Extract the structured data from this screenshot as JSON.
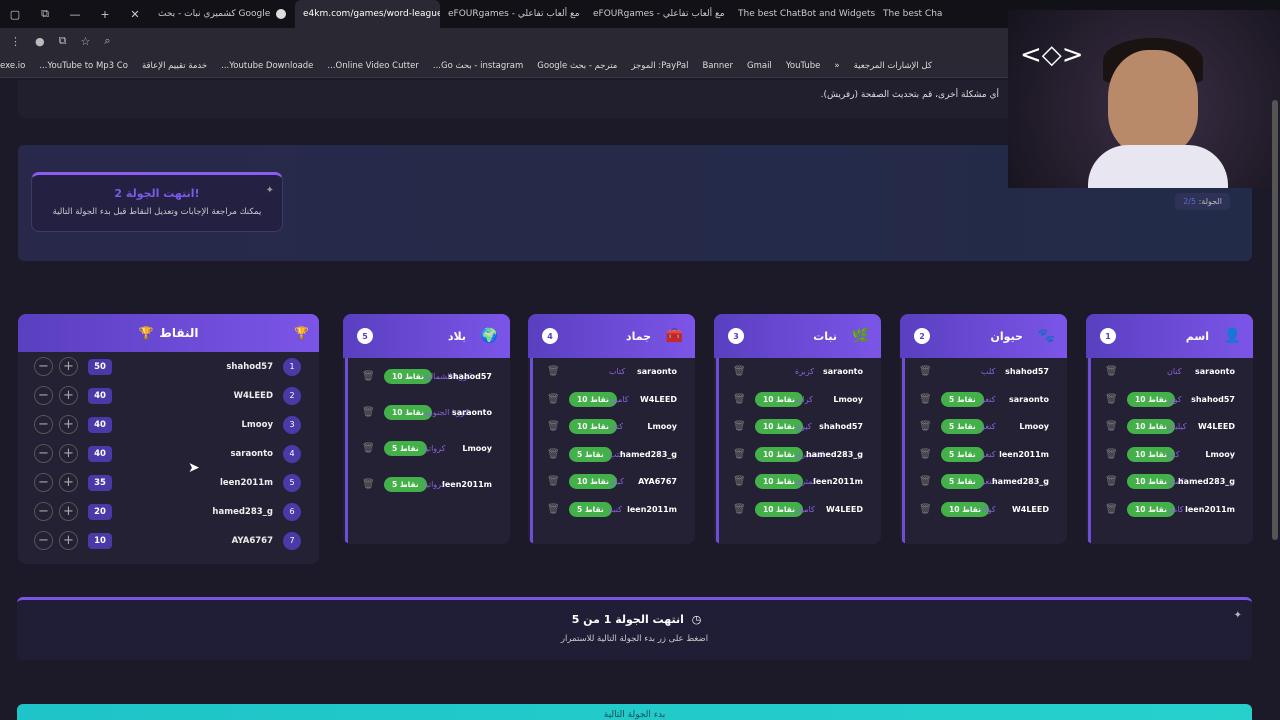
{
  "browser": {
    "tabs": [
      {
        "title": "كشميري نبات - بحث Google",
        "active": false
      },
      {
        "title": "e4km.com/games/word-league",
        "active": true
      },
      {
        "title": "eFOURgames - مع ألعاب تفاعلي",
        "active": false
      },
      {
        "title": "eFOURgames - مع ألعاب تفاعلي",
        "active": false
      },
      {
        "title": "The best ChatBot and Widgets",
        "active": false
      },
      {
        "title": "The best Cha",
        "active": false
      }
    ],
    "bookmarks": [
      "كل الإشارات المرجعية",
      "YouTube",
      "Gmail",
      "Banner",
      "PayPal: الموجز",
      "مترجم - بحث Google",
      "instagram - بحث Go...",
      "Online Video Cutter...",
      "Youtube Downloade...",
      "خدمة تقييم الإعاقة",
      "YouTube to Mp3 Co...",
      "exe.io"
    ]
  },
  "notice": "أي مشكلة أخرى، قم بتحديث الصفحة (رفريش).",
  "hero": {
    "ended_title": "انتهت الجولة 2!",
    "ended_subtitle": "يمكنك مراجعة الإجابات وتعديل النقاط قبل بدء الجولة التالية",
    "round_label": "الجولة:",
    "round_value": "2/5"
  },
  "scoreboard": {
    "title": "النقاط",
    "rows": [
      {
        "rank": "1",
        "name": "shahod57",
        "points": "50"
      },
      {
        "rank": "2",
        "name": "W4LEED",
        "points": "40"
      },
      {
        "rank": "3",
        "name": "Lmooy",
        "points": "40"
      },
      {
        "rank": "4",
        "name": "saraonto",
        "points": "40"
      },
      {
        "rank": "5",
        "name": "leen2011m",
        "points": "35"
      },
      {
        "rank": "6",
        "name": "hamed283_g",
        "points": "20"
      },
      {
        "rank": "7",
        "name": "AYA6767",
        "points": "10"
      }
    ]
  },
  "categories": [
    {
      "num": "5",
      "name": "بلاد",
      "icon": "🌍",
      "answers": [
        {
          "player": "shahod57",
          "word": "كوريا الشمالية",
          "points": "10 نقاط"
        },
        {
          "player": "saraonto",
          "word": "كوريا الجنوبية",
          "points": "10 نقاط"
        },
        {
          "player": "Lmooy",
          "word": "كرواتيا",
          "points": "5 نقاط"
        },
        {
          "player": "leen2011m",
          "word": "كرواتيا",
          "points": "5 نقاط"
        }
      ]
    },
    {
      "num": "4",
      "name": "جماد",
      "icon": "🧰",
      "answers": [
        {
          "player": "saraonto",
          "word": "كتاب",
          "points": ""
        },
        {
          "player": "W4LEED",
          "word": "كاميرا",
          "points": "10 نقاط"
        },
        {
          "player": "Lmooy",
          "word": "كتب",
          "points": "10 نقاط"
        },
        {
          "player": "hamed283_g",
          "word": "كتب",
          "points": "5 نقاط"
        },
        {
          "player": "AYA6767",
          "word": "كباي",
          "points": "10 نقاط"
        },
        {
          "player": "leen2011m",
          "word": "كنبة",
          "points": "5 نقاط"
        }
      ]
    },
    {
      "num": "3",
      "name": "نبات",
      "icon": "🌿",
      "answers": [
        {
          "player": "saraonto",
          "word": "كزبرة",
          "points": ""
        },
        {
          "player": "Lmooy",
          "word": "كرات",
          "points": "10 نقاط"
        },
        {
          "player": "shahod57",
          "word": "كيوي",
          "points": "10 نقاط"
        },
        {
          "player": "hamed283_g",
          "word": "كشميري",
          "points": "10 نقاط"
        },
        {
          "player": "leen2011m",
          "word": "كمثرى",
          "points": "10 نقاط"
        },
        {
          "player": "W4LEED",
          "word": "كاميتر",
          "points": "10 نقاط"
        }
      ]
    },
    {
      "num": "2",
      "name": "حيوان",
      "icon": "🐾",
      "answers": [
        {
          "player": "shahod57",
          "word": "كلب",
          "points": ""
        },
        {
          "player": "saraonto",
          "word": "كنغر",
          "points": "5 نقاط"
        },
        {
          "player": "Lmooy",
          "word": "كنغر",
          "points": "5 نقاط"
        },
        {
          "player": "leen2011m",
          "word": "كنغر",
          "points": "5 نقاط"
        },
        {
          "player": "hamed283_g",
          "word": "كنغر",
          "points": "5 نقاط"
        },
        {
          "player": "W4LEED",
          "word": "كوالا",
          "points": "10 نقاط"
        }
      ]
    },
    {
      "num": "1",
      "name": "اسم",
      "icon": "👤",
      "answers": [
        {
          "player": "saraonto",
          "word": "كنان",
          "points": ""
        },
        {
          "player": "shahod57",
          "word": "كوثر",
          "points": "10 نقاط"
        },
        {
          "player": "W4LEED",
          "word": "كيليان",
          "points": "10 نقاط"
        },
        {
          "player": "Lmooy",
          "word": "كندا",
          "points": "10 نقاط"
        },
        {
          "player": "hamed283_g",
          "word": "كمال",
          "points": "10 نقاط"
        },
        {
          "player": "leen2011m",
          "word": "كامل",
          "points": "10 نقاط"
        }
      ]
    }
  ],
  "end_bar": {
    "title": "انتهت الجولة 1 من 5",
    "subtitle": "اضغط على زر بدء الجولة التالية للاستمرار"
  },
  "next_button": "بدء الجولة التالية",
  "colors": {
    "accent": "#7b55e8",
    "points_badge": "#43b04a",
    "next_button": "#1ec4c8"
  }
}
